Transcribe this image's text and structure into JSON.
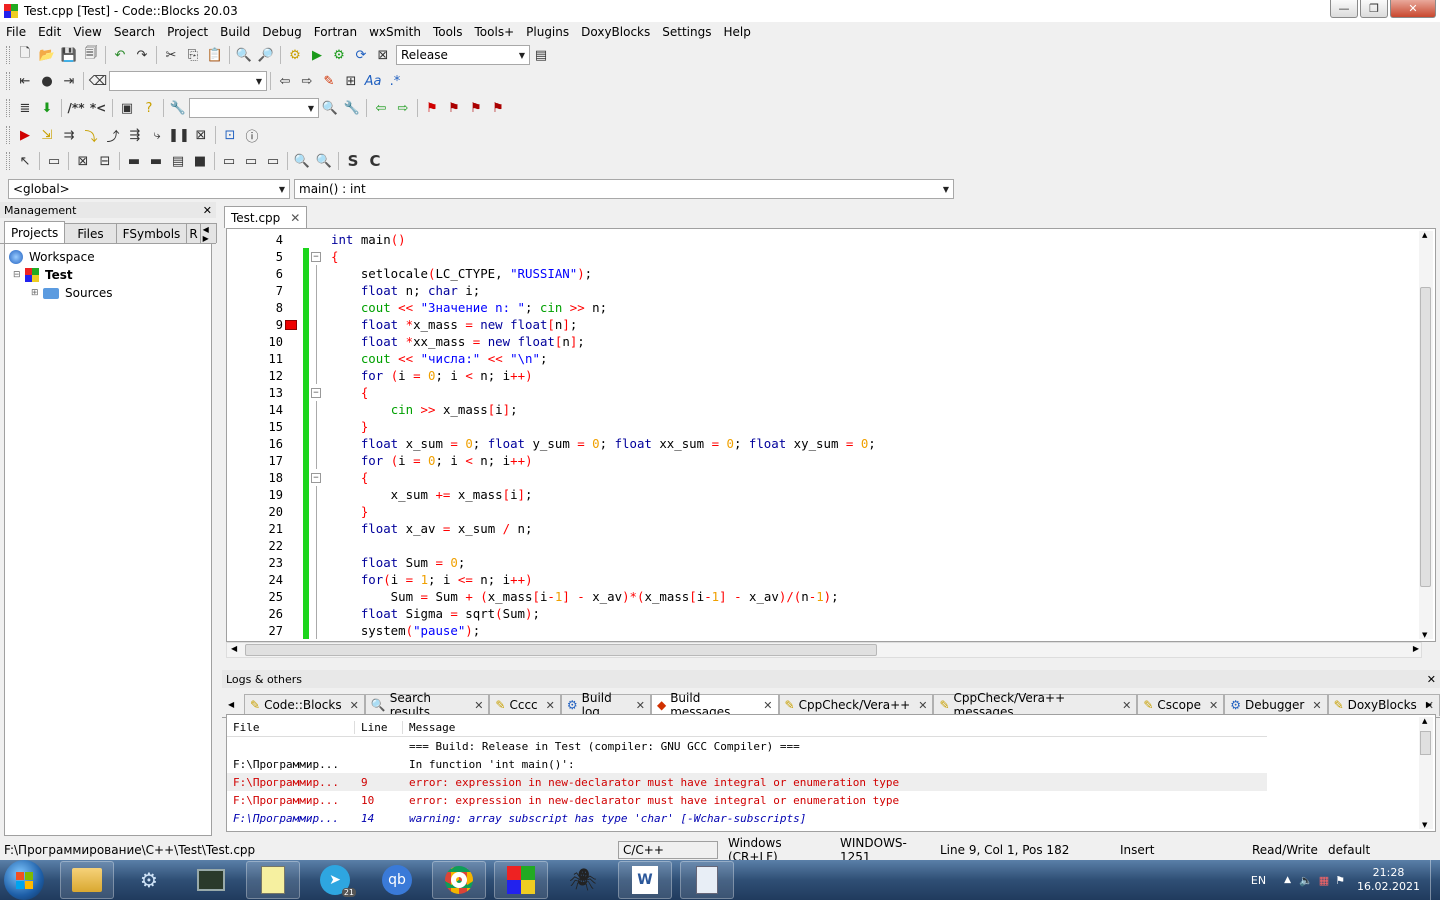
{
  "window": {
    "title": "Test.cpp [Test] - Code::Blocks 20.03"
  },
  "menu": [
    "File",
    "Edit",
    "View",
    "Search",
    "Project",
    "Build",
    "Debug",
    "Fortran",
    "wxSmith",
    "Tools",
    "Tools+",
    "Plugins",
    "DoxyBlocks",
    "Settings",
    "Help"
  ],
  "toolbar": {
    "build_target": "Release"
  },
  "scope": {
    "left": "<global>",
    "right": "main() : int"
  },
  "management": {
    "title": "Management",
    "tabs": [
      "Projects",
      "Files",
      "FSymbols",
      "R"
    ],
    "tree": {
      "workspace": "Workspace",
      "project": "Test",
      "folder": "Sources"
    }
  },
  "editor": {
    "tab": "Test.cpp",
    "lines": [
      {
        "n": "4",
        "text": "int main()"
      },
      {
        "n": "5",
        "text": "{"
      },
      {
        "n": "6",
        "text": "    setlocale(LC_CTYPE, \"RUSSIAN\");"
      },
      {
        "n": "7",
        "text": "    float n; char i;"
      },
      {
        "n": "8",
        "text": "    cout << \"Значение n: \"; cin >> n;"
      },
      {
        "n": "9",
        "text": "    float *x_mass = new float[n];"
      },
      {
        "n": "10",
        "text": "    float *xx_mass = new float[n];"
      },
      {
        "n": "11",
        "text": "    cout << \"числа:\" << \"\\n\";"
      },
      {
        "n": "12",
        "text": "    for (i = 0; i < n; i++)"
      },
      {
        "n": "13",
        "text": "    {"
      },
      {
        "n": "14",
        "text": "        cin >> x_mass[i];"
      },
      {
        "n": "15",
        "text": "    }"
      },
      {
        "n": "16",
        "text": "    float x_sum = 0; float y_sum = 0; float xx_sum = 0; float xy_sum = 0;"
      },
      {
        "n": "17",
        "text": "    for (i = 0; i < n; i++)"
      },
      {
        "n": "18",
        "text": "    {"
      },
      {
        "n": "19",
        "text": "        x_sum += x_mass[i];"
      },
      {
        "n": "20",
        "text": "    }"
      },
      {
        "n": "21",
        "text": "    float x_av = x_sum / n;"
      },
      {
        "n": "22",
        "text": ""
      },
      {
        "n": "23",
        "text": "    float Sum = 0;"
      },
      {
        "n": "24",
        "text": "    for(i = 1; i <= n; i++)"
      },
      {
        "n": "25",
        "text": "        Sum = Sum + (x_mass[i-1] - x_av)*(x_mass[i-1] - x_av)/(n-1);"
      },
      {
        "n": "26",
        "text": "    float Sigma = sqrt(Sum);"
      },
      {
        "n": "27",
        "text": "    system(\"pause\");"
      }
    ]
  },
  "logs": {
    "title": "Logs & others",
    "tabs": [
      "Code::Blocks",
      "Search results",
      "Cccc",
      "Build log",
      "Build messages",
      "CppCheck/Vera++",
      "CppCheck/Vera++ messages",
      "Cscope",
      "Debugger",
      "DoxyBlocks"
    ],
    "columns": [
      "File",
      "Line",
      "Message"
    ],
    "rows": [
      {
        "file": "",
        "line": "",
        "msg": "=== Build: Release in Test (compiler: GNU GCC Compiler) ===",
        "kind": "info"
      },
      {
        "file": "F:\\Программир...",
        "line": "",
        "msg": "In function 'int main()':",
        "kind": "info"
      },
      {
        "file": "F:\\Программир...",
        "line": "9",
        "msg": "error: expression in new-declarator must have integral or enumeration type",
        "kind": "error"
      },
      {
        "file": "F:\\Программир...",
        "line": "10",
        "msg": "error: expression in new-declarator must have integral or enumeration type",
        "kind": "error"
      },
      {
        "file": "F:\\Программир...",
        "line": "14",
        "msg": "warning: array subscript has type 'char' [-Wchar-subscripts]",
        "kind": "warning"
      }
    ]
  },
  "status": {
    "path": "F:\\Программирование\\C++\\Test\\Test.cpp",
    "lang": "C/C++",
    "eol": "Windows (CR+LF)",
    "encoding": "WINDOWS-1251",
    "position": "Line 9, Col 1, Pos 182",
    "mode": "Insert",
    "access": "Read/Write",
    "profile": "default"
  },
  "taskbar": {
    "lang": "EN",
    "time": "21:28",
    "date": "16.02.2021",
    "telegram_badge": "21"
  }
}
